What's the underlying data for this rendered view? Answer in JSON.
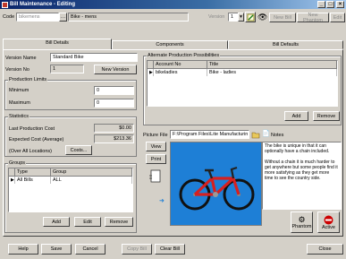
{
  "window": {
    "title": "Bill Maintenance - Editing",
    "min": "_",
    "max": "□",
    "close": "×"
  },
  "header": {
    "code_label": "Code",
    "code_value": "bikemens",
    "code_desc": "Bike - mens",
    "version_label": "Version",
    "version_value": "1",
    "new_bill": "New Bill",
    "new_phantom": "New Phantom",
    "edit": "Edit"
  },
  "tabs": [
    "Bill Details",
    "Components",
    "Bill Defaults"
  ],
  "details": {
    "version_name_label": "Version Name",
    "version_name": "Standard Bike",
    "version_no_label": "Version No",
    "version_no": "1",
    "new_version": "New Version",
    "limits_title": "Production Limits",
    "minimum_label": "Minimum",
    "minimum": "0",
    "maximum_label": "Maximum",
    "maximum": "0",
    "stats_title": "Statistics",
    "last_cost_label": "Last Production Cost",
    "last_cost": "$0.00",
    "expected_cost_label": "Expected Cost (Average)",
    "expected_cost": "$213.36",
    "over_all_label": "(Over All Locations)",
    "costs_button": "Costs...",
    "groups_title": "Groups",
    "groups_columns": [
      "Type",
      "Group"
    ],
    "groups_rows": [
      [
        "All Bills",
        "ALL"
      ]
    ],
    "add": "Add",
    "edit": "Edit",
    "remove": "Remove"
  },
  "alternate": {
    "title": "Alternate Production Possibilities",
    "columns": [
      "Account No",
      "Title"
    ],
    "rows": [
      [
        "bikeladies",
        "Bike - ladies"
      ]
    ],
    "add": "Add",
    "remove": "Remove"
  },
  "picture": {
    "label": "Picture File",
    "path": "F:\\Program Files\\Lite Manufacturin",
    "notes_label": "Notes",
    "view": "View",
    "print": "Print",
    "notes_text": "The bike is unique in that it can optionally have a chain included.\n\nWithout a chain it is much harder to get anywhere but some people find it more satisfying as they get more time to see the country side."
  },
  "phantom": "Phantom",
  "active": "Active",
  "footer": {
    "help": "Help",
    "save": "Save",
    "cancel": "Cancel",
    "copy_bill": "Copy Bill",
    "clear_bill": "Clear Bill",
    "close": "Close"
  },
  "colors": {
    "title_start": "#0a246a",
    "bike_bg": "#1e7fd6",
    "bike_frame": "#d62020",
    "active_red": "#cc0000"
  }
}
